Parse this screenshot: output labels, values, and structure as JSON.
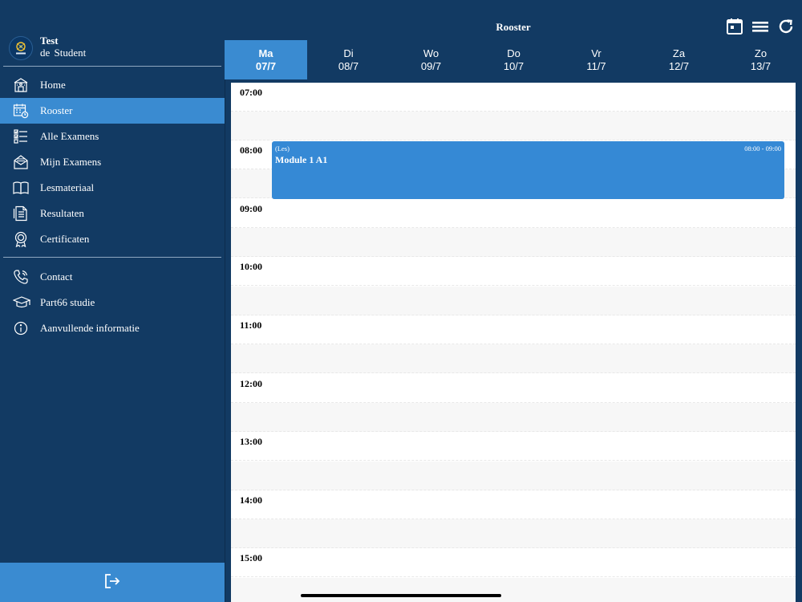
{
  "colors": {
    "sidebar_bg": "#123a63",
    "accent": "#3a8bd1",
    "event": "#3589d5"
  },
  "sidebar": {
    "logo_icon": "school-logo-icon",
    "user_first": "Test",
    "user_last": "de  Student",
    "nav": [
      {
        "label": "Home",
        "icon": "school-building-icon"
      },
      {
        "label": "Rooster",
        "icon": "calendar-clock-icon"
      },
      {
        "label": "Alle Examens",
        "icon": "checklist-icon"
      },
      {
        "label": "Mijn Examens",
        "icon": "envelope-icon"
      },
      {
        "label": "Lesmateriaal",
        "icon": "open-book-icon"
      },
      {
        "label": "Resultaten",
        "icon": "document-list-icon"
      },
      {
        "label": "Certificaten",
        "icon": "award-badge-icon"
      }
    ],
    "nav2": [
      {
        "label": "Contact",
        "icon": "phone-icon"
      },
      {
        "label": "Part66 studie",
        "icon": "graduation-cap-icon"
      },
      {
        "label": "Aanvullende informatie",
        "icon": "info-icon"
      }
    ],
    "logout_icon": "logout-icon"
  },
  "header": {
    "title": "Rooster",
    "icons": [
      "calendar-icon",
      "menu-icon",
      "refresh-icon"
    ]
  },
  "days": [
    {
      "name": "Ma",
      "date": "07/7"
    },
    {
      "name": "Di",
      "date": "08/7"
    },
    {
      "name": "Wo",
      "date": "09/7"
    },
    {
      "name": "Do",
      "date": "10/7"
    },
    {
      "name": "Vr",
      "date": "11/7"
    },
    {
      "name": "Za",
      "date": "12/7"
    },
    {
      "name": "Zo",
      "date": "13/7"
    }
  ],
  "times": [
    "07:00",
    "08:00",
    "09:00",
    "10:00",
    "11:00",
    "12:00",
    "13:00",
    "14:00",
    "15:00"
  ],
  "event": {
    "type": "(Les)",
    "title": "Module 1 A1",
    "time_range": "08:00 - 09:00"
  }
}
